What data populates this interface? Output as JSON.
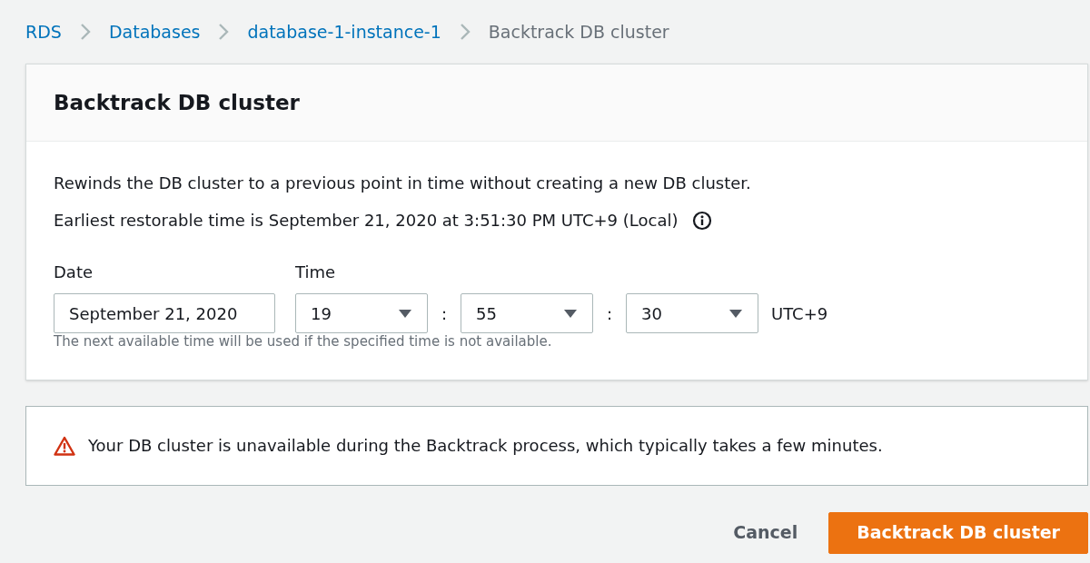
{
  "breadcrumb": [
    {
      "label": "RDS",
      "link": true
    },
    {
      "label": "Databases",
      "link": true
    },
    {
      "label": "database-1-instance-1",
      "link": true
    },
    {
      "label": "Backtrack DB cluster",
      "link": false
    }
  ],
  "card": {
    "title": "Backtrack DB cluster",
    "description": "Rewinds the DB cluster to a previous point in time without creating a new DB cluster.",
    "earliest": "Earliest restorable time is September 21, 2020 at 3:51:30 PM UTC+9 (Local)",
    "date": {
      "label": "Date",
      "value": "September 21, 2020"
    },
    "time": {
      "label": "Time",
      "parts": [
        "19",
        "55",
        "30"
      ],
      "separator": ":",
      "zone": "UTC+9"
    },
    "hint": "The next available time will be used if the specified time is not available."
  },
  "alert": {
    "text": "Your DB cluster is unavailable during the Backtrack process, which typically takes a few minutes."
  },
  "buttons": [
    {
      "label": "Cancel",
      "kind": "link"
    },
    {
      "label": "Backtrack DB cluster",
      "kind": "primary"
    }
  ]
}
